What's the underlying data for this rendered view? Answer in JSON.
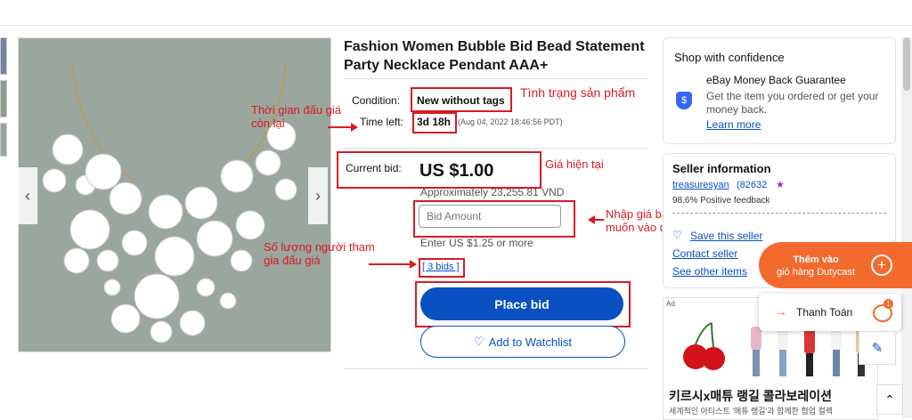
{
  "product": {
    "title": "Fashion Women Bubble Bid Bead Statement Party Necklace Pendant AAA+",
    "condition_label": "Condition:",
    "condition_value": "New without tags",
    "time_left_label": "Time left:",
    "time_left_value": "3d 18h",
    "time_left_date": "(Aug 04, 2022 18:46:56 PDT)",
    "current_bid_label": "Current bid:",
    "current_bid_value": "US $1.00",
    "approx": "Approximately 23,255.81 VND",
    "bid_input_placeholder": "Bid Amount",
    "enter_hint": "Enter US $1.25 or more",
    "bids_link": "[ 3 bids ]",
    "place_bid": "Place bid",
    "add_watchlist": "Add to Watchlist"
  },
  "annotations": {
    "condition": "Tình trạng sản phẩm",
    "time_left": "Thời gian đấu giá còn lại",
    "current_bid": "Giá hiện tại",
    "bid_input": "Nhập giá bạn muốn vào đây",
    "bidders": "Số lượng người tham gia đấu giá"
  },
  "confidence": {
    "heading": "Shop with confidence",
    "guarantee_title": "eBay Money Back Guarantee",
    "guarantee_text": "Get the item you ordered or get your money back.",
    "learn_more": "Learn more"
  },
  "seller": {
    "heading": "Seller information",
    "name": "treasuresyan",
    "score": "(82632",
    "feedback": "98.6% Positive feedback",
    "save_seller": "Save this seller",
    "contact": "Contact seller",
    "other_items": "See other items"
  },
  "ad": {
    "label": "Ad",
    "headline": "키르시x매튜 랭길 콜라보레이션",
    "subline": "세계적인 아티스트 '매튜 랭길'과 함께한 협업 컬렉"
  },
  "floating": {
    "cart_line1": "Thêm vào",
    "cart_line2": "giỏ hàng Dutycast",
    "pay": "Thanh Toán",
    "cart_count": "1"
  },
  "colors": {
    "annotation_red": "#d81b22",
    "ebay_blue": "#0a50c2",
    "cart_orange": "#f26a2e"
  }
}
